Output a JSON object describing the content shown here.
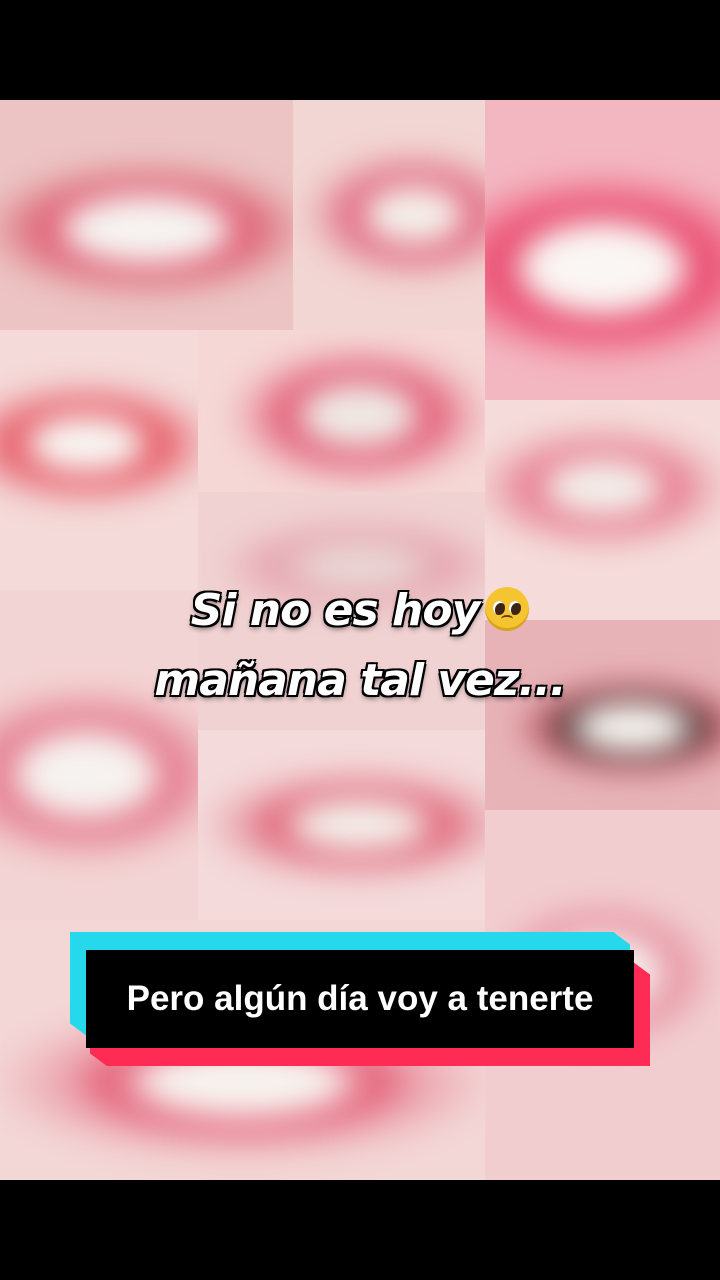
{
  "caption": {
    "line1": "Si no es hoy",
    "line1_emoji": "pleading-face-emoji",
    "line2": "mañana tal vez..."
  },
  "banner": {
    "text": "Pero algún día voy a tenerte"
  },
  "colors": {
    "cyan_accent": "#25d8ec",
    "red_accent": "#fe2c55",
    "lip_pink": "#e8466a",
    "skin": "#f1d4d2"
  }
}
